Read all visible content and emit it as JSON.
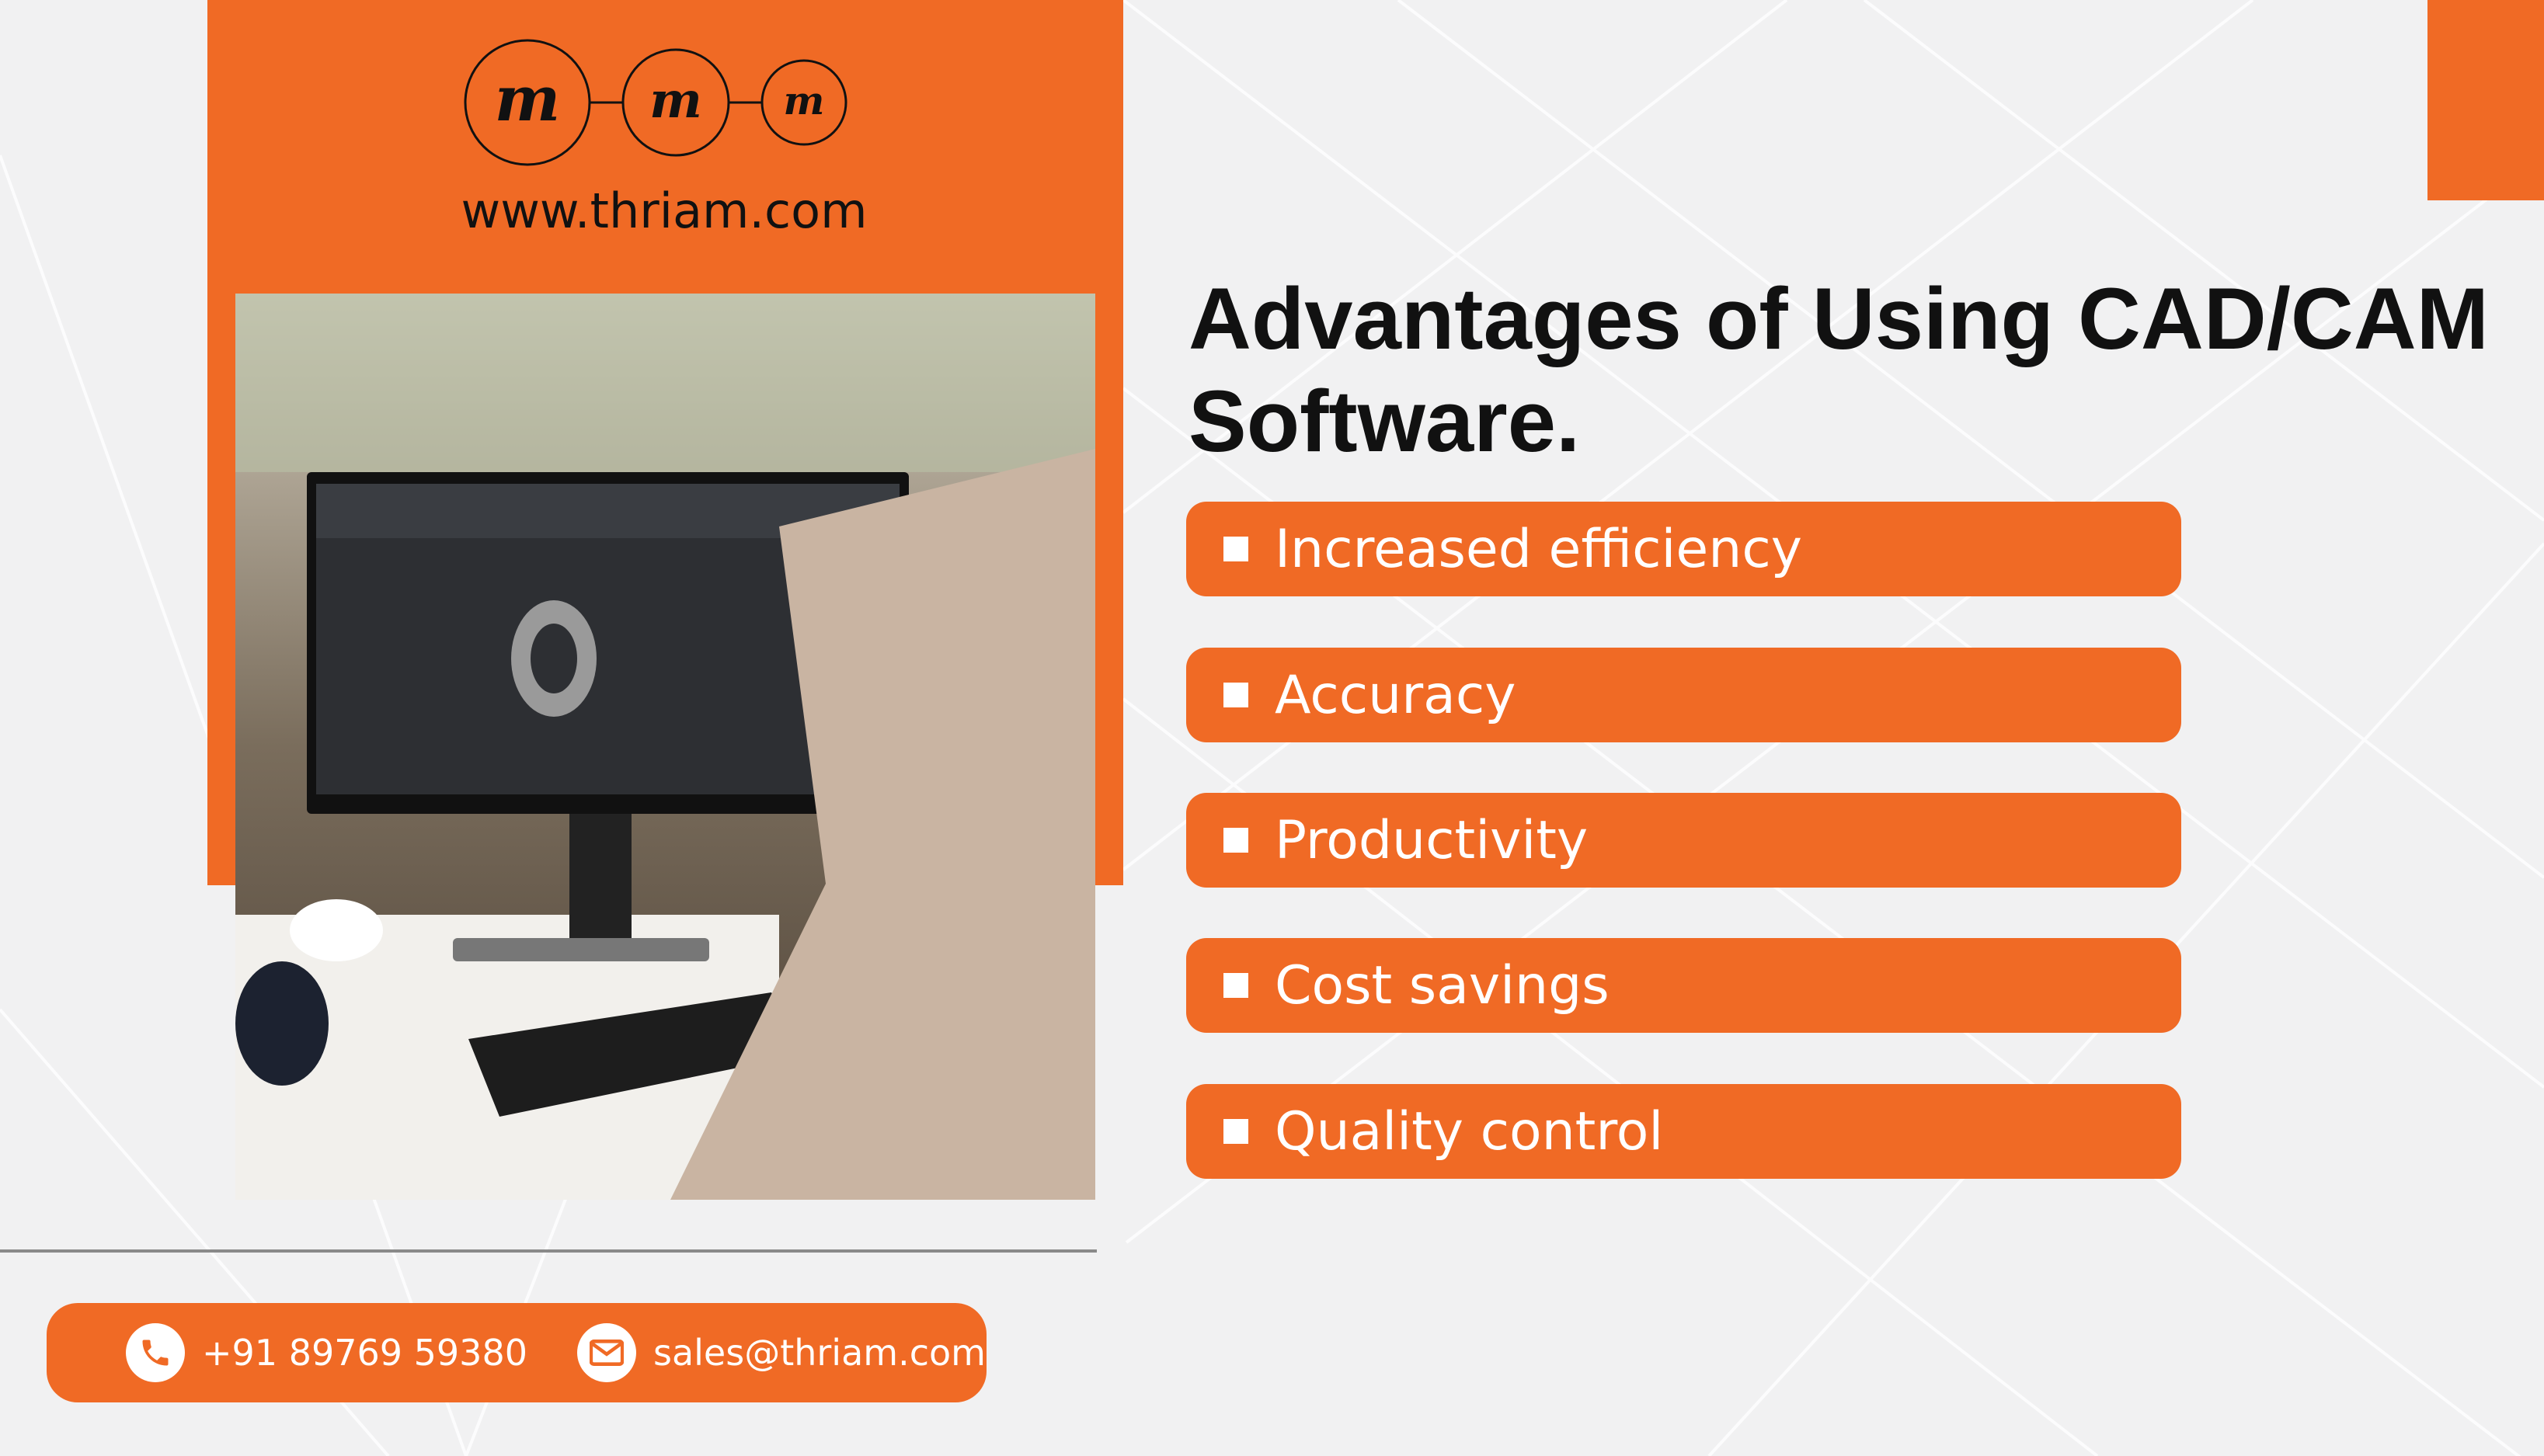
{
  "brand": {
    "logo_letters": [
      "m",
      "m",
      "m"
    ],
    "url": "www.thriam.com",
    "accent": "#f06a25"
  },
  "title": {
    "line1": "Advantages of Using CAD/CAM",
    "line2": "Software."
  },
  "advantages": [
    {
      "label": "Increased efficiency"
    },
    {
      "label": "Accuracy"
    },
    {
      "label": "Productivity"
    },
    {
      "label": "Cost savings"
    },
    {
      "label": "Quality control"
    }
  ],
  "contact": {
    "phone": "+91 89769 59380",
    "email": "sales@thriam.com",
    "phone_icon": "phone-icon",
    "email_icon": "mail-icon"
  }
}
